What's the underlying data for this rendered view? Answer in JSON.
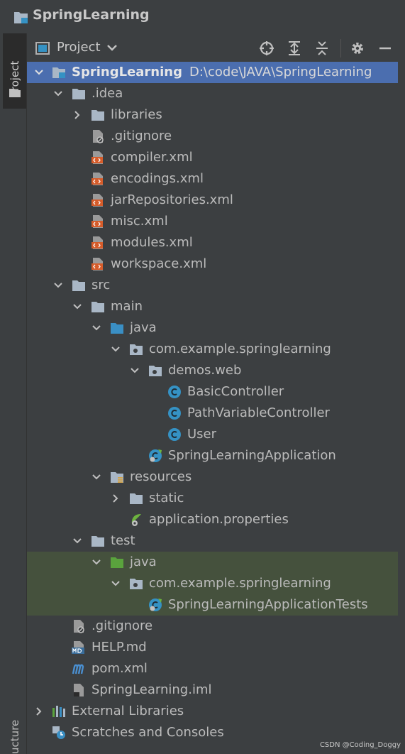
{
  "window": {
    "title": "SpringLearning"
  },
  "stripe": {
    "project_tab": "Project",
    "structure_tab": "ucture"
  },
  "toolwindow": {
    "title": "Project"
  },
  "tree": {
    "root": {
      "name": "SpringLearning",
      "path": "D:\\code\\JAVA\\SpringLearning"
    },
    "rows": [
      {
        "label": ".idea"
      },
      {
        "label": "libraries"
      },
      {
        "label": ".gitignore"
      },
      {
        "label": "compiler.xml"
      },
      {
        "label": "encodings.xml"
      },
      {
        "label": "jarRepositories.xml"
      },
      {
        "label": "misc.xml"
      },
      {
        "label": "modules.xml"
      },
      {
        "label": "workspace.xml"
      },
      {
        "label": "src"
      },
      {
        "label": "main"
      },
      {
        "label": "java"
      },
      {
        "label": "com.example.springlearning"
      },
      {
        "label": "demos.web"
      },
      {
        "label": "BasicController"
      },
      {
        "label": "PathVariableController"
      },
      {
        "label": "User"
      },
      {
        "label": "SpringLearningApplication"
      },
      {
        "label": "resources"
      },
      {
        "label": "static"
      },
      {
        "label": "application.properties"
      },
      {
        "label": "test"
      },
      {
        "label": "java"
      },
      {
        "label": "com.example.springlearning"
      },
      {
        "label": "SpringLearningApplicationTests"
      },
      {
        "label": ".gitignore"
      },
      {
        "label": "HELP.md"
      },
      {
        "label": "pom.xml"
      },
      {
        "label": "SpringLearning.iml"
      },
      {
        "label": "External Libraries"
      },
      {
        "label": "Scratches and Consoles"
      }
    ]
  },
  "watermark": "CSDN @Coding_Doggy",
  "colors": {
    "selection": "#4b6eaf",
    "test_highlight": "#45513d",
    "background": "#3c3f41"
  }
}
